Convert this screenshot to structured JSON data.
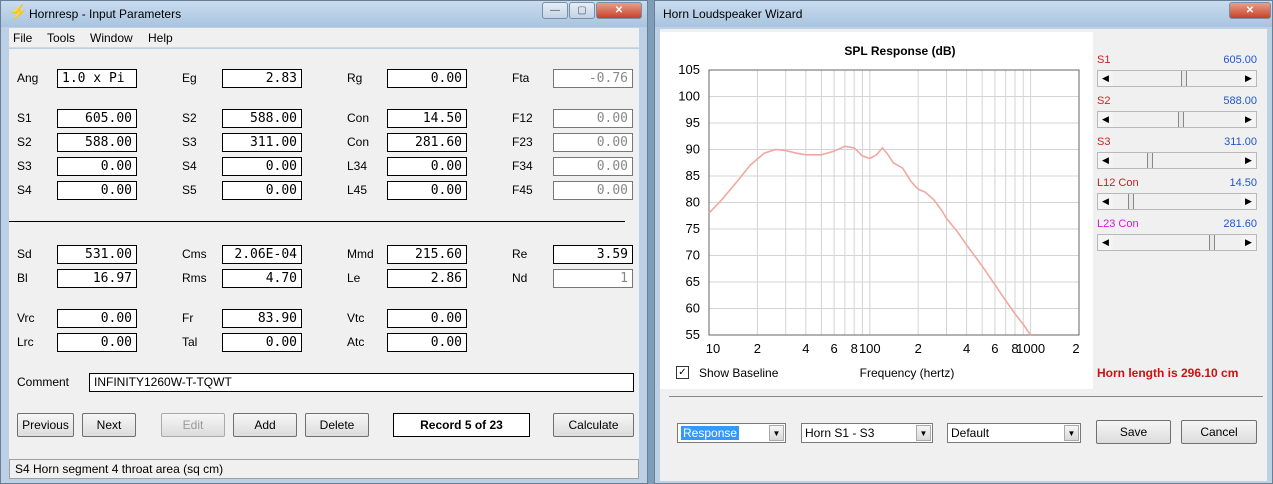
{
  "left_window": {
    "title": "Hornresp - Input Parameters",
    "menu": [
      "File",
      "Tools",
      "Window",
      "Help"
    ],
    "rows1": [
      [
        {
          "label": "Ang",
          "value": "1.0 x Pi",
          "ro": false
        },
        {
          "label": "Eg",
          "value": "2.83",
          "ro": false
        },
        {
          "label": "Rg",
          "value": "0.00",
          "ro": false
        },
        {
          "label": "Fta",
          "value": "-0.76",
          "ro": true
        }
      ],
      [
        {
          "label": "S1",
          "value": "605.00",
          "ro": false
        },
        {
          "label": "S2",
          "value": "588.00",
          "ro": false
        },
        {
          "label": "Con",
          "value": "14.50",
          "ro": false
        },
        {
          "label": "F12",
          "value": "0.00",
          "ro": true
        }
      ],
      [
        {
          "label": "S2",
          "value": "588.00",
          "ro": false
        },
        {
          "label": "S3",
          "value": "311.00",
          "ro": false
        },
        {
          "label": "Con",
          "value": "281.60",
          "ro": false
        },
        {
          "label": "F23",
          "value": "0.00",
          "ro": true
        }
      ],
      [
        {
          "label": "S3",
          "value": "0.00",
          "ro": false
        },
        {
          "label": "S4",
          "value": "0.00",
          "ro": false
        },
        {
          "label": "L34",
          "value": "0.00",
          "ro": false
        },
        {
          "label": "F34",
          "value": "0.00",
          "ro": true
        }
      ],
      [
        {
          "label": "S4",
          "value": "0.00",
          "ro": false
        },
        {
          "label": "S5",
          "value": "0.00",
          "ro": false
        },
        {
          "label": "L45",
          "value": "0.00",
          "ro": false
        },
        {
          "label": "F45",
          "value": "0.00",
          "ro": true
        }
      ]
    ],
    "rows2": [
      [
        {
          "label": "Sd",
          "value": "531.00",
          "ro": false
        },
        {
          "label": "Cms",
          "value": "2.06E-04",
          "ro": false
        },
        {
          "label": "Mmd",
          "value": "215.60",
          "ro": false
        },
        {
          "label": "Re",
          "value": "3.59",
          "ro": false
        }
      ],
      [
        {
          "label": "Bl",
          "value": "16.97",
          "ro": false
        },
        {
          "label": "Rms",
          "value": "4.70",
          "ro": false
        },
        {
          "label": "Le",
          "value": "2.86",
          "ro": false
        },
        {
          "label": "Nd",
          "value": "1",
          "ro": true
        }
      ],
      [
        {
          "label": "Vrc",
          "value": "0.00",
          "ro": false
        },
        {
          "label": "Fr",
          "value": "83.90",
          "ro": false
        },
        {
          "label": "Vtc",
          "value": "0.00",
          "ro": false
        }
      ],
      [
        {
          "label": "Lrc",
          "value": "0.00",
          "ro": false
        },
        {
          "label": "Tal",
          "value": "0.00",
          "ro": false
        },
        {
          "label": "Atc",
          "value": "0.00",
          "ro": false
        }
      ]
    ],
    "comment_label": "Comment",
    "comment_value": "INFINITY1260W-T-TQWT",
    "buttons": {
      "previous": "Previous",
      "next": "Next",
      "edit": "Edit",
      "add": "Add",
      "delete": "Delete",
      "calculate": "Calculate"
    },
    "record": "Record 5 of 23",
    "status": "S4   Horn segment 4 throat area  (sq cm)"
  },
  "right_window": {
    "title": "Horn Loudspeaker Wizard",
    "show_baseline": "Show Baseline",
    "horn_length": "Horn length is 296.10 cm",
    "sliders": [
      {
        "label": "S1",
        "value": "605.00",
        "color": "#cc2222",
        "pos": 0.55
      },
      {
        "label": "S2",
        "value": "588.00",
        "color": "#cc2222",
        "pos": 0.53
      },
      {
        "label": "S3",
        "value": "311.00",
        "color": "#cc2222",
        "pos": 0.28
      },
      {
        "label": "L12  Con",
        "value": "14.50",
        "color": "#cc2222",
        "pos": 0.12
      },
      {
        "label": "L23  Con",
        "value": "281.60",
        "color": "#cc22cc",
        "pos": 0.78
      }
    ],
    "combos": [
      "Response",
      "Horn S1 - S3",
      "Default"
    ],
    "buttons": {
      "save": "Save",
      "cancel": "Cancel"
    }
  },
  "chart_data": {
    "type": "line",
    "title": "SPL Response (dB)",
    "xlabel": "Frequency (hertz)",
    "ylabel": "",
    "x_scale": "log",
    "xlim": [
      10,
      2000
    ],
    "ylim": [
      55,
      105
    ],
    "grid": true,
    "xticks": [
      "10",
      "2",
      "4",
      "6",
      "8",
      "100",
      "2",
      "4",
      "6",
      "8",
      "1000",
      "2"
    ],
    "yticks": [
      "105",
      "100",
      "95",
      "90",
      "85",
      "80",
      "75",
      "70",
      "65",
      "60",
      "55"
    ],
    "series": [
      {
        "color": "#f0a8a0",
        "points": [
          [
            10,
            78
          ],
          [
            12,
            80.5
          ],
          [
            15,
            84
          ],
          [
            18,
            87
          ],
          [
            22,
            89.3
          ],
          [
            26,
            90
          ],
          [
            30,
            89.8
          ],
          [
            35,
            89.3
          ],
          [
            40,
            89
          ],
          [
            50,
            89
          ],
          [
            60,
            89.7
          ],
          [
            70,
            90.6
          ],
          [
            80,
            90.3
          ],
          [
            90,
            88.8
          ],
          [
            100,
            88.3
          ],
          [
            110,
            89
          ],
          [
            120,
            90.3
          ],
          [
            130,
            89
          ],
          [
            140,
            87.5
          ],
          [
            160,
            86.5
          ],
          [
            180,
            84
          ],
          [
            200,
            82.5
          ],
          [
            220,
            82
          ],
          [
            250,
            80.5
          ],
          [
            280,
            78.5
          ],
          [
            300,
            77
          ],
          [
            350,
            74.5
          ],
          [
            400,
            72
          ],
          [
            500,
            68
          ],
          [
            600,
            64.5
          ],
          [
            700,
            61.5
          ],
          [
            800,
            59
          ],
          [
            900,
            57
          ],
          [
            1000,
            55
          ]
        ]
      }
    ]
  }
}
